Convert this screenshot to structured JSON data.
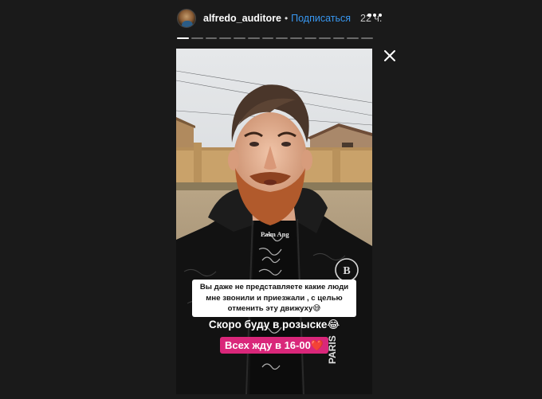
{
  "header": {
    "username": "alfredo_auditore",
    "separator": "•",
    "follow_label": "Подписаться",
    "time": "22 ч.",
    "more_icon": "more-horizontal-icon",
    "avatar_icon": "user-avatar"
  },
  "progress": {
    "segment_count": 14,
    "current_index": 0,
    "current_fill": 1.0
  },
  "close_icon": "close-icon",
  "story": {
    "caption_1": "Вы даже не представляете какие люди мне звонили и приезжали , с целью отменить эту движуху😅",
    "caption_2": "Скоро буду в розыске😂",
    "caption_3": "Всех жду в 16-00❤️",
    "shirt_text": "Palm Ang",
    "jacket_badge": "B",
    "jacket_text": "PARIS",
    "caption_3_color": "#d9277a"
  },
  "colors": {
    "background": "#1a1a1a",
    "follow": "#3897f0"
  }
}
